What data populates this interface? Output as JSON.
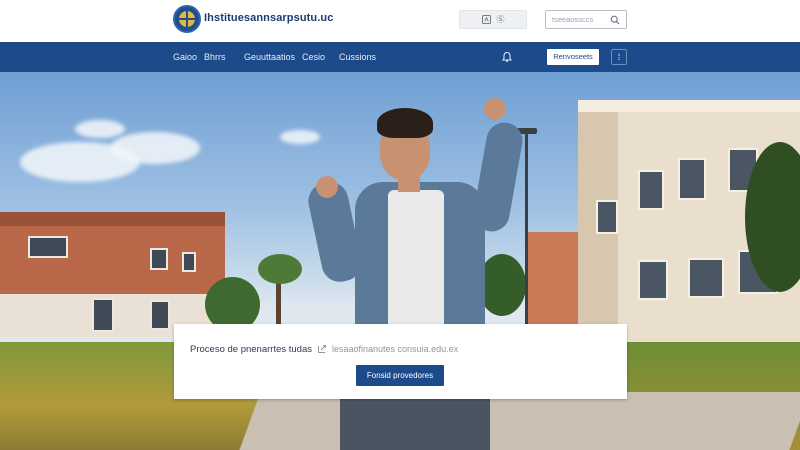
{
  "header": {
    "site_name": "Ihstituesannsarpsutu.uc",
    "top_button_label": "Ⓢ",
    "search": {
      "placeholder": "tseeaossccs"
    }
  },
  "nav": {
    "items": [
      {
        "label": "Gaioo"
      },
      {
        "label": "Bhrrs"
      },
      {
        "label": "Geuuttaatios"
      },
      {
        "label": "Cesio"
      },
      {
        "label": "Cussions"
      }
    ],
    "action_button_label": "Renvoseets",
    "menu_icon_label": "⁞"
  },
  "card": {
    "label": "Proceso de pnenarrtes tudas",
    "link_text": "lesaaofinanutes consuia.edu.ex",
    "button_label": "Fonsid provedores"
  },
  "colors": {
    "brand_blue": "#1d4a8a",
    "nav_text": "#e6edf7",
    "link_gray": "#8e96a1"
  },
  "icons": [
    "logo-emblem-icon",
    "translate-icon",
    "search-icon",
    "notification-bell-icon",
    "menu-icon",
    "link-icon"
  ]
}
